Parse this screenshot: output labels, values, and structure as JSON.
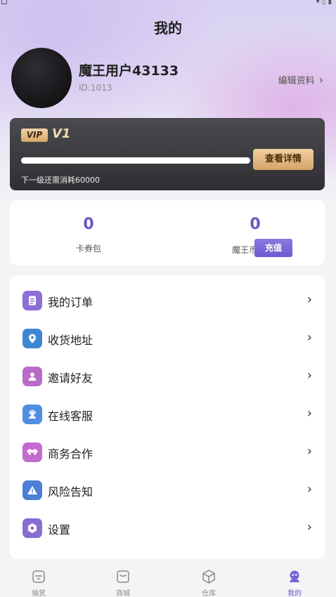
{
  "header": {
    "title": "我的"
  },
  "profile": {
    "name": "魔王用户43133",
    "id_text": "ID:1013",
    "edit_label": "编辑资料"
  },
  "vip": {
    "badge": "VIP",
    "level": "V1",
    "progress": 1.0,
    "detail_button": "查看详情",
    "note": "下一级还需消耗60000"
  },
  "assets": {
    "coupons": {
      "value": "0",
      "label": "卡券包"
    },
    "coins": {
      "value": "0",
      "label": "魔王币"
    },
    "recharge_label": "充值"
  },
  "menu": [
    {
      "label": "我的订单",
      "icon": "order-icon",
      "color": "#8b6fd6"
    },
    {
      "label": "收货地址",
      "icon": "location-icon",
      "color": "#3d86d6"
    },
    {
      "label": "邀请好友",
      "icon": "invite-friend-icon",
      "color": "#b86ac9"
    },
    {
      "label": "在线客服",
      "icon": "customer-service-icon",
      "color": "#4f8ee0"
    },
    {
      "label": "商务合作",
      "icon": "handshake-icon",
      "color": "#c36ad0"
    },
    {
      "label": "风险告知",
      "icon": "warning-icon",
      "color": "#4d7fd9"
    },
    {
      "label": "设置",
      "icon": "settings-icon",
      "color": "#8a6cd6"
    }
  ],
  "bottom_nav": [
    {
      "label": "抽赏",
      "icon": "draw-icon",
      "active": false
    },
    {
      "label": "商城",
      "icon": "shop-icon",
      "active": false
    },
    {
      "label": "仓库",
      "icon": "warehouse-icon",
      "active": false
    },
    {
      "label": "我的",
      "icon": "profile-icon",
      "active": true
    }
  ],
  "colors": {
    "accent": "#6a55c8",
    "vip_gold": "#d6a468",
    "vip_card": "#343438"
  }
}
